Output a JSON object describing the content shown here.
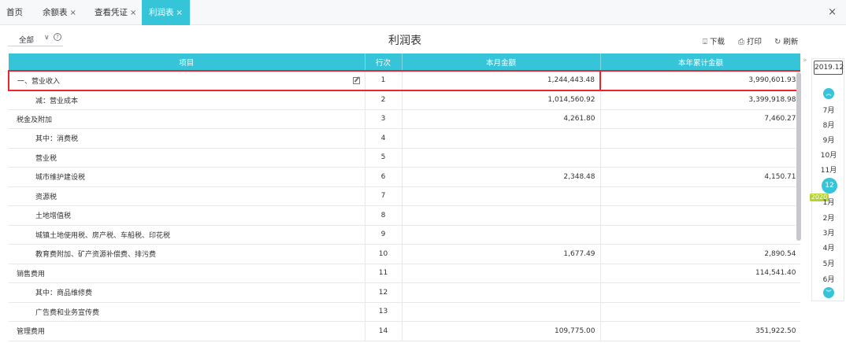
{
  "tabs": [
    {
      "label": "首页",
      "closable": false
    },
    {
      "label": "余额表",
      "closable": true
    },
    {
      "label": "查看凭证",
      "closable": true
    },
    {
      "label": "利润表",
      "closable": true,
      "active": true
    }
  ],
  "tab_close_glyph": "×",
  "close_all_glyph": "×",
  "toolbar": {
    "filter_value": "全部",
    "chevron": "∨",
    "help": "?",
    "title": "利润表",
    "download": "下载",
    "print": "打印",
    "refresh": "刷新"
  },
  "table": {
    "headers": [
      "项目",
      "行次",
      "本月金额",
      "本年累计金额"
    ],
    "rows": [
      {
        "item": "一、营业收入",
        "line": "1",
        "month": "1,244,443.48",
        "ytd": "3,990,601.93"
      },
      {
        "item": "减：营业成本",
        "line": "2",
        "month": "1,014,560.92",
        "ytd": "3,399,918.98"
      },
      {
        "item": "税金及附加",
        "line": "3",
        "month": "4,261.80",
        "ytd": "7,460.27"
      },
      {
        "item": "其中：消费税",
        "line": "4",
        "month": "",
        "ytd": ""
      },
      {
        "item": "营业税",
        "line": "5",
        "month": "",
        "ytd": ""
      },
      {
        "item": "城市维护建设税",
        "line": "6",
        "month": "2,348.48",
        "ytd": "4,150.71"
      },
      {
        "item": "资源税",
        "line": "7",
        "month": "",
        "ytd": ""
      },
      {
        "item": "土地增值税",
        "line": "8",
        "month": "",
        "ytd": ""
      },
      {
        "item": "城镇土地使用税、房产税、车船税、印花税",
        "line": "9",
        "month": "",
        "ytd": ""
      },
      {
        "item": "教育费附加、矿产资源补偿费、排污费",
        "line": "10",
        "month": "1,677.49",
        "ytd": "2,890.54"
      },
      {
        "item": "销售费用",
        "line": "11",
        "month": "",
        "ytd": "114,541.40"
      },
      {
        "item": "其中：商品维修费",
        "line": "12",
        "month": "",
        "ytd": ""
      },
      {
        "item": "广告费和业务宣传费",
        "line": "13",
        "month": "",
        "ytd": ""
      },
      {
        "item": "管理费用",
        "line": "14",
        "month": "109,775.00",
        "ytd": "351,922.50"
      }
    ]
  },
  "period": {
    "year": "2019.12",
    "months_2019": [
      "7月",
      "8月",
      "9月",
      "10月",
      "11月",
      "12月"
    ],
    "year_tag": "2020",
    "months_2020": [
      "1月",
      "2月",
      "3月",
      "4月",
      "5月",
      "6月"
    ],
    "selected": "12月"
  },
  "colors": {
    "accent": "#36c4d8",
    "highlight": "#e8262b",
    "year_tag": "#b5d334"
  }
}
